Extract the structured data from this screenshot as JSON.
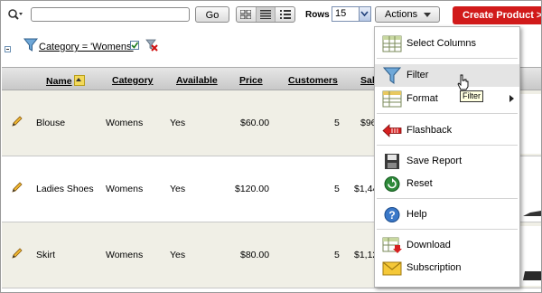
{
  "toolbar": {
    "search_value": "",
    "go_label": "Go",
    "rows_label": "Rows",
    "rows_value": "15",
    "actions_label": "Actions",
    "create_label": "Create Product >"
  },
  "filter": {
    "text": "Category = 'Womens'",
    "enabled": true
  },
  "table": {
    "headers": {
      "name": "Name",
      "category": "Category",
      "available": "Available",
      "price": "Price",
      "customers": "Customers",
      "sales": "Sal"
    },
    "rows": [
      {
        "name": "Blouse",
        "category": "Womens",
        "available": "Yes",
        "price": "$60.00",
        "customers": "5",
        "sales": "$96"
      },
      {
        "name": "Ladies Shoes",
        "category": "Womens",
        "available": "Yes",
        "price": "$120.00",
        "customers": "5",
        "sales": "$1,44"
      },
      {
        "name": "Skirt",
        "category": "Womens",
        "available": "Yes",
        "price": "$80.00",
        "customers": "5",
        "sales": "$1,12"
      }
    ]
  },
  "actions_menu": {
    "items": [
      {
        "label": "Select Columns",
        "icon": "select-columns-icon"
      },
      {
        "label": "Filter",
        "icon": "filter-icon",
        "highlighted": true
      },
      {
        "label": "Format",
        "icon": "format-icon",
        "submenu": true
      },
      {
        "label": "Flashback",
        "icon": "flashback-icon"
      },
      {
        "label": "Save Report",
        "icon": "save-icon"
      },
      {
        "label": "Reset",
        "icon": "reset-icon"
      },
      {
        "label": "Help",
        "icon": "help-icon"
      },
      {
        "label": "Download",
        "icon": "download-icon"
      },
      {
        "label": "Subscription",
        "icon": "subscription-icon"
      }
    ]
  },
  "tooltip": "Filter",
  "colors": {
    "create_button": "#d11a1a",
    "header_bg": "#d6d6d6",
    "alt_row": "#f0efe6"
  }
}
